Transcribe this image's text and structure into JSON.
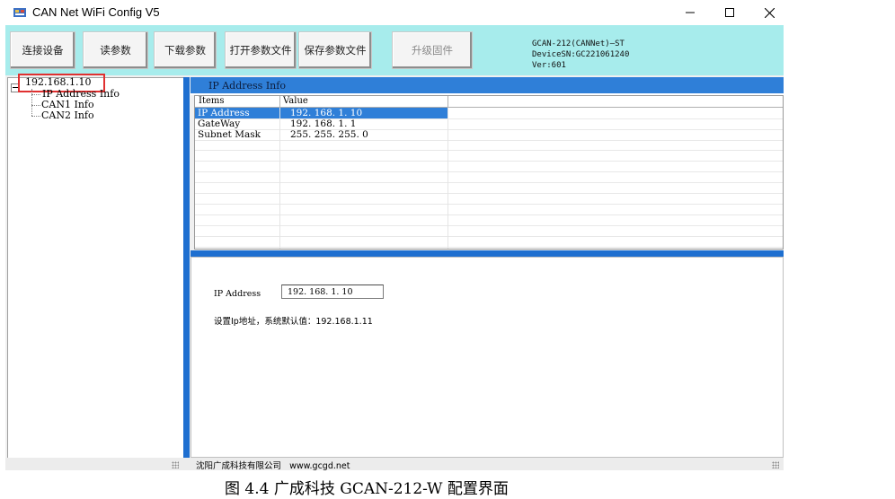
{
  "window": {
    "title": "CAN Net WiFi Config V5",
    "controls": {
      "minimize": "—",
      "maximize": "☐",
      "close": "✕"
    }
  },
  "toolbar": {
    "buttons": [
      {
        "label": "连接设备",
        "enabled": true
      },
      {
        "label": "读参数",
        "enabled": true
      },
      {
        "label": "下载参数",
        "enabled": true
      },
      {
        "label": "打开参数文件",
        "enabled": true
      },
      {
        "label": "保存参数文件",
        "enabled": true
      },
      {
        "label": "升级固件",
        "enabled": false
      }
    ],
    "device_info": {
      "line1": "GCAN-212(CANNet)—ST",
      "line2": "DeviceSN:GC221061240",
      "line3": "Ver:601"
    }
  },
  "tree": {
    "root": "192.168.1.10",
    "children": [
      "IP Address Info",
      "CAN1 Info",
      "CAN2 Info"
    ]
  },
  "ip_group": {
    "title": "IP Address Info",
    "columns": [
      "Items",
      "Value"
    ],
    "rows": [
      {
        "item": "IP Address",
        "value": "192. 168. 1. 10",
        "selected": true
      },
      {
        "item": "GateWay",
        "value": "192. 168. 1. 1",
        "selected": false
      },
      {
        "item": "Subnet Mask",
        "value": "255. 255. 255. 0",
        "selected": false
      }
    ]
  },
  "editor": {
    "ip_label": "IP Address",
    "ip_value": "192. 168. 1. 10",
    "hint": "设置Ip地址，系统默认值：192.168.1.11"
  },
  "statusbar": {
    "company": "沈阳广成科技有限公司",
    "website": "www.gcgd.net"
  },
  "caption": "图 4.4  广成科技 GCAN-212-W 配置界面",
  "colors": {
    "toolbar_bg": "#a7ecec",
    "accent_blue": "#2f7fd8",
    "highlight_box": "#e03030"
  }
}
